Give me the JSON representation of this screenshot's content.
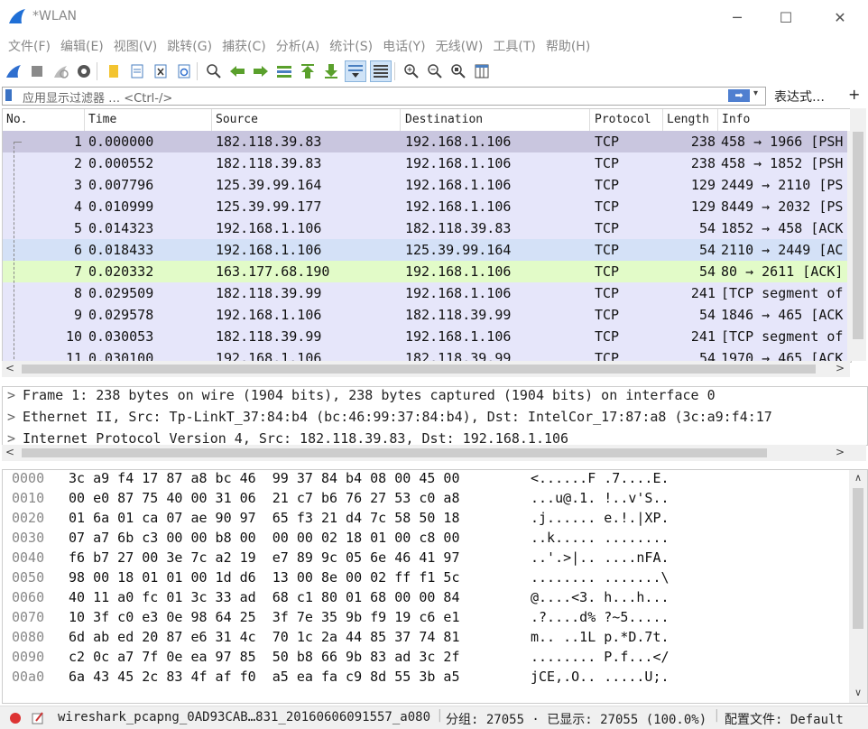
{
  "window": {
    "title": "*WLAN",
    "minimize": "─",
    "maximize": "☐",
    "close": "✕"
  },
  "menu": [
    "文件(F)",
    "编辑(E)",
    "视图(V)",
    "跳转(G)",
    "捕获(C)",
    "分析(A)",
    "统计(S)",
    "电话(Y)",
    "无线(W)",
    "工具(T)",
    "帮助(H)"
  ],
  "filter": {
    "placeholder": "应用显示过滤器 … <Ctrl-/>",
    "apply_glyph": "➡",
    "dropdown_glyph": "▾",
    "expression": "表达式…",
    "add": "+"
  },
  "packet_list": {
    "columns": [
      "No.",
      "Time",
      "Source",
      "Destination",
      "Protocol",
      "Length",
      "Info"
    ],
    "rows": [
      {
        "no": "1",
        "time": "0.000000",
        "src": "182.118.39.83",
        "dst": "192.168.1.106",
        "proto": "TCP",
        "len": "238",
        "info": "458 → 1966 [PSH"
      },
      {
        "no": "2",
        "time": "0.000552",
        "src": "182.118.39.83",
        "dst": "192.168.1.106",
        "proto": "TCP",
        "len": "238",
        "info": "458 → 1852 [PSH"
      },
      {
        "no": "3",
        "time": "0.007796",
        "src": "125.39.99.164",
        "dst": "192.168.1.106",
        "proto": "TCP",
        "len": "129",
        "info": "2449 → 2110 [PS"
      },
      {
        "no": "4",
        "time": "0.010999",
        "src": "125.39.99.177",
        "dst": "192.168.1.106",
        "proto": "TCP",
        "len": "129",
        "info": "8449 → 2032 [PS"
      },
      {
        "no": "5",
        "time": "0.014323",
        "src": "192.168.1.106",
        "dst": "182.118.39.83",
        "proto": "TCP",
        "len": "54",
        "info": "1852 → 458 [ACK"
      },
      {
        "no": "6",
        "time": "0.018433",
        "src": "192.168.1.106",
        "dst": "125.39.99.164",
        "proto": "TCP",
        "len": "54",
        "info": "2110 → 2449 [AC"
      },
      {
        "no": "7",
        "time": "0.020332",
        "src": "163.177.68.190",
        "dst": "192.168.1.106",
        "proto": "TCP",
        "len": "54",
        "info": "80 → 2611 [ACK]"
      },
      {
        "no": "8",
        "time": "0.029509",
        "src": "182.118.39.99",
        "dst": "192.168.1.106",
        "proto": "TCP",
        "len": "241",
        "info": "[TCP segment of"
      },
      {
        "no": "9",
        "time": "0.029578",
        "src": "192.168.1.106",
        "dst": "182.118.39.99",
        "proto": "TCP",
        "len": "54",
        "info": "1846 → 465 [ACK"
      },
      {
        "no": "10",
        "time": "0.030053",
        "src": "182.118.39.99",
        "dst": "192.168.1.106",
        "proto": "TCP",
        "len": "241",
        "info": "[TCP segment of"
      },
      {
        "no": "11",
        "time": "0.030100",
        "src": "192.168.1.106",
        "dst": "182.118.39.99",
        "proto": "TCP",
        "len": "54",
        "info": "1970 → 465 [ACK"
      }
    ],
    "row_colors": [
      "#c9c6df",
      "#e6e6fa",
      "#e6e6fa",
      "#e6e6fa",
      "#e6e6fa",
      "#d4e1f7",
      "#e2fbc8",
      "#e6e6fa",
      "#e6e6fa",
      "#e6e6fa",
      "#e6e6fa"
    ]
  },
  "details": [
    "Frame 1: 238 bytes on wire (1904 bits), 238 bytes captured (1904 bits) on interface 0",
    "Ethernet II, Src: Tp-LinkT_37:84:b4 (bc:46:99:37:84:b4), Dst: IntelCor_17:87:a8 (3c:a9:f4:17",
    "Internet Protocol Version 4, Src: 182.118.39.83, Dst: 192.168.1.106"
  ],
  "bytes": [
    {
      "off": "0000",
      "hex": "3c a9 f4 17 87 a8 bc 46  99 37 84 b4 08 00 45 00",
      "ascii": "<......F .7....E."
    },
    {
      "off": "0010",
      "hex": "00 e0 87 75 40 00 31 06  21 c7 b6 76 27 53 c0 a8",
      "ascii": "...u@.1. !..v'S.."
    },
    {
      "off": "0020",
      "hex": "01 6a 01 ca 07 ae 90 97  65 f3 21 d4 7c 58 50 18",
      "ascii": ".j...... e.!.|XP."
    },
    {
      "off": "0030",
      "hex": "07 a7 6b c3 00 00 b8 00  00 00 02 18 01 00 c8 00",
      "ascii": "..k..... ........"
    },
    {
      "off": "0040",
      "hex": "f6 b7 27 00 3e 7c a2 19  e7 89 9c 05 6e 46 41 97",
      "ascii": "..'.>|.. ....nFA."
    },
    {
      "off": "0050",
      "hex": "98 00 18 01 01 00 1d d6  13 00 8e 00 02 ff f1 5c",
      "ascii": "........ .......\\"
    },
    {
      "off": "0060",
      "hex": "40 11 a0 fc 01 3c 33 ad  68 c1 80 01 68 00 00 84",
      "ascii": "@....<3. h...h..."
    },
    {
      "off": "0070",
      "hex": "10 3f c0 e3 0e 98 64 25  3f 7e 35 9b f9 19 c6 e1",
      "ascii": ".?....d% ?~5....."
    },
    {
      "off": "0080",
      "hex": "6d ab ed 20 87 e6 31 4c  70 1c 2a 44 85 37 74 81",
      "ascii": "m.. ..1L p.*D.7t."
    },
    {
      "off": "0090",
      "hex": "c2 0c a7 7f 0e ea 97 85  50 b8 66 9b 83 ad 3c 2f",
      "ascii": "........ P.f...</"
    },
    {
      "off": "00a0",
      "hex": "6a 43 45 2c 83 4f af f0  a5 ea fa c9 8d 55 3b a5",
      "ascii": "jCE,.O.. .....U;."
    }
  ],
  "status": {
    "file": "wireshark_pcapng_0AD93CAB…831_20160606091557_a08068",
    "packets": "分组: 27055 · 已显示: 27055 (100.0%)",
    "profile": "配置文件: Default"
  },
  "colors": {
    "accent": "#3a72c4",
    "selected_row": "#c9c6df"
  }
}
